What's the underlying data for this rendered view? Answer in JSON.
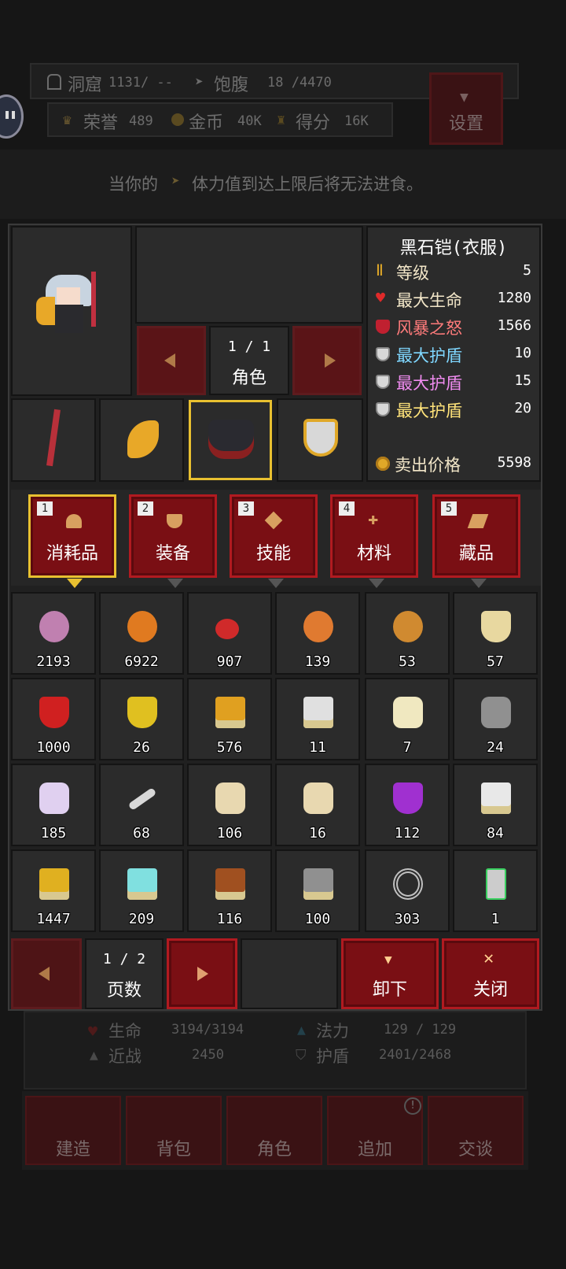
{
  "header": {
    "cave_label": "洞窟",
    "cave_value": "1131/ --",
    "hunger_label": "饱腹",
    "hunger_value": "18 /4470",
    "honor_label": "荣誉",
    "honor_value": "489",
    "gold_label": "金币",
    "gold_value": "40K",
    "score_label": "得分",
    "score_value": "16K",
    "settings_label": "设置"
  },
  "hint": {
    "prefix": "当你的",
    "suffix": "体力值到达上限后将无法进食。"
  },
  "character": {
    "page": "1 / 1",
    "page_label": "角色"
  },
  "item_info": {
    "name": "黑石铠(衣服)",
    "stats": [
      {
        "label": "等级",
        "value": "5",
        "color": "#f2e6c8",
        "icon": "level-icon"
      },
      {
        "label": "最大生命",
        "value": "1280",
        "color": "#f2e6c8",
        "icon": "heart-icon"
      },
      {
        "label": "风暴之怒",
        "value": "1566",
        "color": "#ff7b7b",
        "icon": "red-shield-icon"
      },
      {
        "label": "最大护盾",
        "value": "10",
        "color": "#7fd7ff",
        "icon": "shield-icon"
      },
      {
        "label": "最大护盾",
        "value": "15",
        "color": "#f08cf0",
        "icon": "shield-icon"
      },
      {
        "label": "最大护盾",
        "value": "20",
        "color": "#ffe37a",
        "icon": "shield-icon"
      }
    ],
    "sell_label": "卖出价格",
    "sell_value": "5598"
  },
  "tabs": [
    {
      "num": "1",
      "label": "消耗品",
      "icon": "flask-icon",
      "selected": true
    },
    {
      "num": "2",
      "label": "装备",
      "icon": "shield-icon",
      "selected": false
    },
    {
      "num": "3",
      "label": "技能",
      "icon": "diamond-icon",
      "selected": false
    },
    {
      "num": "4",
      "label": "材料",
      "icon": "cross-icon",
      "selected": false
    },
    {
      "num": "5",
      "label": "藏品",
      "icon": "scroll-icon",
      "selected": false
    }
  ],
  "inventory": [
    {
      "icon": "turnip-icon",
      "count": "2193",
      "color": "#c080b0"
    },
    {
      "icon": "pumpkin-icon",
      "count": "6922",
      "color": "#e07a20"
    },
    {
      "icon": "cherry-icon",
      "count": "907",
      "color": "#d02a2a"
    },
    {
      "icon": "burger-icon",
      "count": "139",
      "color": "#e07a30"
    },
    {
      "icon": "big-burger-icon",
      "count": "53",
      "color": "#d08a30"
    },
    {
      "icon": "bottle-icon",
      "count": "57",
      "color": "#e8d8a0"
    },
    {
      "icon": "red-potion-icon",
      "count": "1000",
      "color": "#d02020"
    },
    {
      "icon": "yellow-potion-icon",
      "count": "26",
      "color": "#e0c020"
    },
    {
      "icon": "medal-icon",
      "count": "576",
      "color": "#e0a020"
    },
    {
      "icon": "sword-medal-icon",
      "count": "11",
      "color": "#e0e0e0"
    },
    {
      "icon": "jar-icon",
      "count": "7",
      "color": "#f0e8c0"
    },
    {
      "icon": "cloth-roll-icon",
      "count": "24",
      "color": "#909090"
    },
    {
      "icon": "crown-icon",
      "count": "185",
      "color": "#e0d0f0"
    },
    {
      "icon": "bone-icon",
      "count": "68",
      "color": "#d8d8d8"
    },
    {
      "icon": "scroll-icon",
      "count": "106",
      "color": "#e8d8b0"
    },
    {
      "icon": "scroll-icon",
      "count": "16",
      "color": "#e8d8b0"
    },
    {
      "icon": "purple-potion-icon",
      "count": "112",
      "color": "#a030d0"
    },
    {
      "icon": "wings-statue-icon",
      "count": "84",
      "color": "#e8e8e8"
    },
    {
      "icon": "gold-statue-icon",
      "count": "1447",
      "color": "#e0b020"
    },
    {
      "icon": "crystal-statue-icon",
      "count": "209",
      "color": "#80e0e0"
    },
    {
      "icon": "tree-statue-icon",
      "count": "116",
      "color": "#a05020"
    },
    {
      "icon": "bat-statue-icon",
      "count": "100",
      "color": "#909090"
    },
    {
      "icon": "target-icon",
      "count": "303",
      "color": "#c0c0c0"
    },
    {
      "icon": "card-icon",
      "count": "1",
      "color": "#cccccc"
    }
  ],
  "pager": {
    "page": "1 / 2",
    "label": "页数"
  },
  "actions": {
    "unequip": "卸下",
    "close": "关闭"
  },
  "player_stats": {
    "hp_label": "生命",
    "hp_value": "3194/3194",
    "mp_label": "法力",
    "mp_value": "129 / 129",
    "melee_label": "近战",
    "melee_value": "2450",
    "shield_label": "护盾",
    "shield_value": "2401/2468"
  },
  "nav": {
    "build": "建造",
    "bag": "背包",
    "role": "角色",
    "add": "追加",
    "talk": "交谈",
    "badge": "!"
  }
}
